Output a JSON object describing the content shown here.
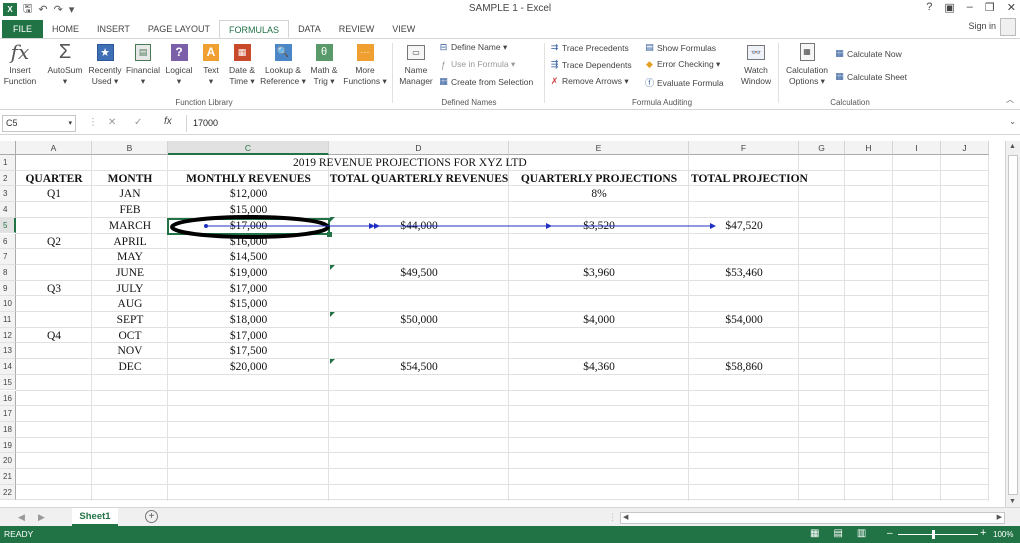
{
  "window": {
    "title": "SAMPLE 1 - Excel",
    "signin": "Sign in",
    "help": "?"
  },
  "quick_access": {
    "save_icon": "save-icon",
    "undo": "↶",
    "redo": "↷",
    "customize": "▾"
  },
  "tabs": [
    {
      "label": "FILE"
    },
    {
      "label": "HOME"
    },
    {
      "label": "INSERT"
    },
    {
      "label": "PAGE LAYOUT"
    },
    {
      "label": "FORMULAS"
    },
    {
      "label": "DATA"
    },
    {
      "label": "REVIEW"
    },
    {
      "label": "VIEW"
    }
  ],
  "ribbon": {
    "function_library": {
      "label": "Function Library",
      "insert_function": {
        "l1": "Insert",
        "l2": "Function"
      },
      "autosum": {
        "l1": "AutoSum",
        "l2": "▾"
      },
      "recently_used": {
        "l1": "Recently",
        "l2": "Used ▾"
      },
      "financial": {
        "l1": "Financial",
        "l2": "▾"
      },
      "logical": {
        "l1": "Logical",
        "l2": "▾"
      },
      "text": {
        "l1": "Text",
        "l2": "▾"
      },
      "date_time": {
        "l1": "Date &",
        "l2": "Time ▾"
      },
      "lookup": {
        "l1": "Lookup &",
        "l2": "Reference ▾"
      },
      "math": {
        "l1": "Math &",
        "l2": "Trig ▾"
      },
      "more": {
        "l1": "More",
        "l2": "Functions ▾"
      }
    },
    "defined_names": {
      "label": "Defined Names",
      "name_manager": {
        "l1": "Name",
        "l2": "Manager"
      },
      "define_name": "Define Name ▾",
      "use_in_formula": "Use in Formula ▾",
      "create_from_selection": "Create from Selection"
    },
    "formula_auditing": {
      "label": "Formula Auditing",
      "trace_precedents": "Trace Precedents",
      "trace_dependents": "Trace Dependents",
      "remove_arrows": "Remove Arrows ▾",
      "show_formulas": "Show Formulas",
      "error_checking": "Error Checking ▾",
      "evaluate_formula": "Evaluate Formula",
      "watch_window": {
        "l1": "Watch",
        "l2": "Window"
      }
    },
    "calculation": {
      "label": "Calculation",
      "options": {
        "l1": "Calculation",
        "l2": "Options ▾"
      },
      "calc_now": "Calculate Now",
      "calc_sheet": "Calculate Sheet"
    }
  },
  "formula_bar": {
    "name_box": "C5",
    "cancel": "✕",
    "enter": "✓",
    "fx": "fx",
    "value": "17000"
  },
  "columns": [
    "A",
    "B",
    "C",
    "D",
    "E",
    "F",
    "G",
    "H",
    "I",
    "J"
  ],
  "rows": [
    "1",
    "2",
    "3",
    "4",
    "5",
    "6",
    "7",
    "8",
    "9",
    "10",
    "11",
    "12",
    "13",
    "14",
    "15",
    "16",
    "17",
    "18",
    "19",
    "20",
    "21",
    "22"
  ],
  "sheet": {
    "title": "2019 REVENUE PROJECTIONS FOR XYZ LTD",
    "headers": {
      "quarter": "QUARTER",
      "month": "MONTH",
      "monthly": "MONTHLY REVENUES",
      "total_q": "TOTAL QUARTERLY REVENUES",
      "q_proj": "QUARTERLY PROJECTIONS",
      "total_proj": "TOTAL PROJECTION"
    },
    "growth_rate": "8%",
    "quarters": [
      "Q1",
      "Q2",
      "Q3",
      "Q4"
    ],
    "months": [
      "JAN",
      "FEB",
      "MARCH",
      "APRIL",
      "MAY",
      "JUNE",
      "JULY",
      "AUG",
      "SEPT",
      "OCT",
      "NOV",
      "DEC"
    ],
    "monthly_revenues": [
      "$12,000",
      "$15,000",
      "$17,000",
      "$16,000",
      "$14,500",
      "$19,000",
      "$17,000",
      "$15,000",
      "$18,000",
      "$17,000",
      "$17,500",
      "$20,000"
    ],
    "quarter_totals": [
      "$44,000",
      "$49,500",
      "$50,000",
      "$54,500"
    ],
    "quarter_projections": [
      "$3,520",
      "$3,960",
      "$4,000",
      "$4,360"
    ],
    "total_projections": [
      "$47,520",
      "$53,460",
      "$54,000",
      "$58,860"
    ]
  },
  "sheet_tabs": {
    "active": "Sheet1",
    "add": "+"
  },
  "status": {
    "text": "READY",
    "zoom": "100%"
  },
  "colors": {
    "accent": "#217346",
    "trace_arrow": "#2030c0"
  }
}
